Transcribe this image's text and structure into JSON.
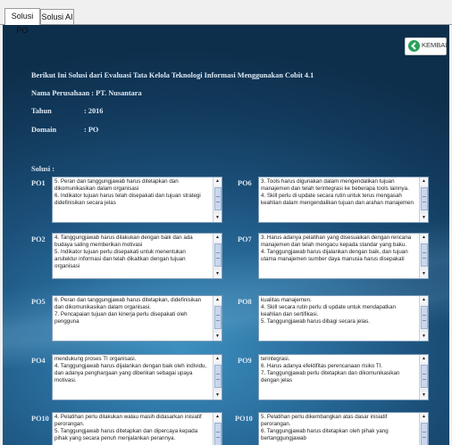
{
  "tabs": [
    {
      "label": "Solusi PO"
    },
    {
      "label": "Solusi AI"
    }
  ],
  "header": {
    "title": "Berikut Ini Solusi dari Evaluasi Tata Kelola Teknologi Informasi Menggunakan Cobit 4.1",
    "company_label": "Nama Perusahaan : PT. Nusantara",
    "year_label": "Tahun",
    "year_value": ": 2016",
    "domain_label": "Domain",
    "domain_value": ": PO"
  },
  "back_button": {
    "label": "KEMBALI",
    "icon": "back-arrow-icon",
    "color": "#2aa05a"
  },
  "solusi_label": "Solusi :",
  "solutions": [
    {
      "code": "PO1",
      "text": "5. Peran dan tanggungjawab harus ditetapkan dan dikomunikasikan dalam organisasi\n6. Indikator tujuan harus telah disepakati dan tujuan strategi didefinisikan secara jelas"
    },
    {
      "code": "PO6",
      "text": "3. Tools harus digunakan dalam mengendalikan tujuan manajemen dan telah terintegrasi ke beberapa tools lainnya.\n4. Skill perlu di update secara rutin untuk terus mengasah keahlian dalam mengendalikan tujuan dan arahan manajemen"
    },
    {
      "code": "PO2",
      "text": "4. Tanggungjawab harus dilakukan dengan baik dan ada budaya saling memberikan motivasi\n5. Indikator tujuan perlu disepakati untuk menentukan arsitektur informasi dan telah dikaitkan dengan tujuan organisasi"
    },
    {
      "code": "PO7",
      "text": "3. Harus adanya pelatihan yang disesuaikan dengan rencana manajemen dan telah mengacu kepada standar yang baku.\n4. Tanggungjawab harus dijalankan dengan baik, dan tujuan utama manajemen sumber daya manusia harus disepakati"
    },
    {
      "code": "PO5",
      "text": "6. Peran dan tanggungjawab harus ditetapkan, didefinisikan dan dikomunikasikan dalam organisasi.\n7. Pencapaian tujuan dan kinerja perlu disepakati oleh pengguna"
    },
    {
      "code": "PO8",
      "text": "kualitas manajemen.\n4. Skill secara rutin perlu di update untuk mendapatkan keahlian dan sertifikasi.\n5. Tanggungjawab harus dibagi secara jelas."
    },
    {
      "code": "PO4",
      "text": "mendukung proses TI organisasi.\n4. Tanggungjawab harus dijalankan dengan baik oleh individu, dan adanya penghargaan yang diberikan sebagai upaya motivasi."
    },
    {
      "code": "PO9",
      "text": "terintegrasi.\n6. Harus adanya efektifitas perencanaan risiko TI.\n7. Tanggungjawab perlu ditetapkan dan dikomunikasikan dengan jelas"
    },
    {
      "code": "PO10",
      "text": "4. Pelatihan perlu dilakukan walau masih didasarkan inisiatif perorangan.\n5. Tanggungjawab harus ditetapkan dan dipercaya kepada pihak yang secara penuh menjalankan perannya."
    },
    {
      "code": "PO10",
      "text": "5. Pelatihan perlu dikembangkan atas dasar inisiatif perorangan.\n6. Tanggungjawab harus ditetapkan oleh pihak yang bertanggungjawab"
    }
  ]
}
